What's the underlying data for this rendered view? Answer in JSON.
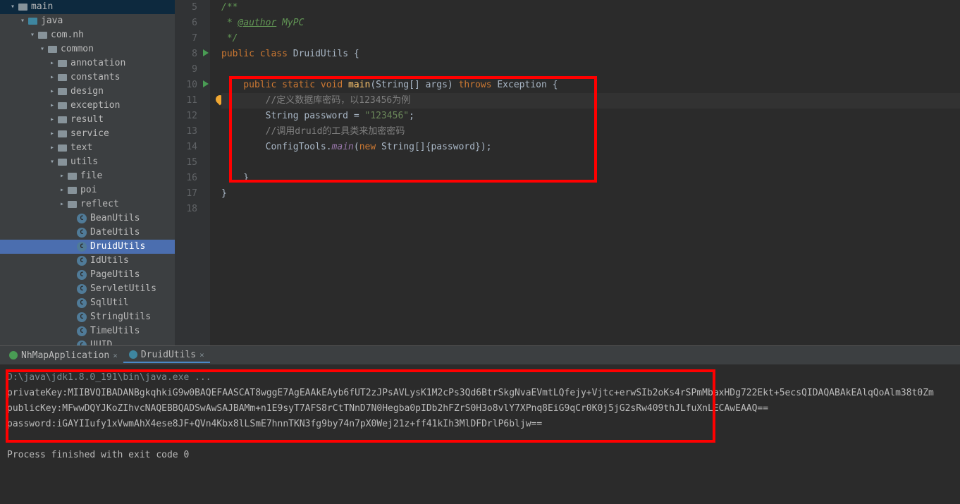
{
  "tree": {
    "main": "main",
    "java": "java",
    "pkg": "com.nh",
    "common": "common",
    "folders": [
      "annotation",
      "constants",
      "design",
      "exception",
      "result",
      "service",
      "text"
    ],
    "utils": "utils",
    "utilsSub": [
      "file",
      "poi",
      "reflect"
    ],
    "classes": [
      "BeanUtils",
      "DateUtils",
      "DruidUtils",
      "IdUtils",
      "PageUtils",
      "ServletUtils",
      "SqlUtil",
      "StringUtils",
      "TimeUtils",
      "UUID"
    ]
  },
  "code": {
    "l5": "/**",
    "l6a": " * ",
    "l6b": "@author",
    "l6c": " MyPC",
    "l7": " */",
    "l8a": "public ",
    "l8b": "class ",
    "l8c": "DruidUtils ",
    "l8d": "{",
    "l10a": "    public static void ",
    "l10b": "main",
    "l10c": "(String[] args) ",
    "l10d": "throws ",
    "l10e": "Exception {",
    "l11": "        //定义数据库密码，以123456为例",
    "l12a": "        String password = ",
    "l12b": "\"123456\"",
    "l12c": ";",
    "l13": "        //调用druid的工具类来加密密码",
    "l14a": "        ConfigTools.",
    "l14b": "main",
    "l14c": "(",
    "l14d": "new ",
    "l14e": "String[]{password});",
    "l16": "    }",
    "l17": "}"
  },
  "gutter": [
    "5",
    "6",
    "7",
    "8",
    "9",
    "10",
    "11",
    "12",
    "13",
    "14",
    "15",
    "16",
    "17",
    "18"
  ],
  "tabs": {
    "t1": "NhMapApplication",
    "t2": "DruidUtils"
  },
  "console": {
    "l1": "D:\\java\\jdk1.8.0_191\\bin\\java.exe ...",
    "l2": "privateKey:MIIBVQIBADANBgkqhkiG9w0BAQEFAASCAT8wggE7AgEAAkEAyb6fUT2zJPsAVLysK1M2cPs3Qd6BtrSkgNvaEVmtLQfejy+Vjtc+erwSIb2oKs4rSPmMbaxHDg722Ekt+5ecsQIDAQABAkEAlqQoAlm38t0Zm",
    "l3": "publicKey:MFwwDQYJKoZIhvcNAQEBBQADSwAwSAJBAMm+n1E9syT7AFS8rCtTNnD7N0Hegba0pIDb2hFZrS0H3o8vlY7XPnq8EiG9qCr0K0j5jG2sRw409thJLfuXnLECAwEAAQ==",
    "l4": "password:iGAYIIufy1xVwmAhX4ese8JF+QVn4Kbx8lLSmE7hnnTKN3fg9by74n7pX0Wej21z+ff41kIh3MlDFDrlP6bljw==",
    "l6": "Process finished with exit code 0"
  }
}
